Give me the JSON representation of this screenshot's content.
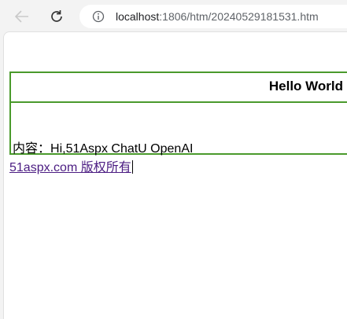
{
  "browser": {
    "url_host": "localhost",
    "url_path": ":1806/htm/20240529181531.htm"
  },
  "page": {
    "title": "Hello World",
    "content_label": "内容：",
    "content_text": "Hi,51Aspx ChatU OpenAI",
    "footer_link": "51aspx.com 版权所有"
  }
}
